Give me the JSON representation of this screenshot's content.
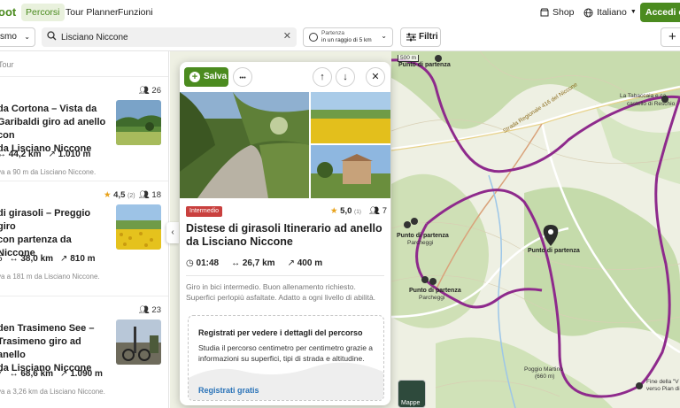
{
  "nav": {
    "brand": "oot",
    "items": [
      "Percorsi",
      "Tour Planner",
      "Funzioni"
    ],
    "shop": "Shop",
    "language": "Italiano",
    "cta": "Accedi o r"
  },
  "search": {
    "sport": "smo",
    "query": "Lisciano Niccone",
    "radius_label": "Partenza",
    "radius_value": "in un raggio di 5 km",
    "filters": "Filtri",
    "add": "+"
  },
  "list": {
    "crumb": "Tour",
    "cards": [
      {
        "title": "da Cortona – Vista da\nGaribaldi giro ad anello con\nda Lisciano Niccone",
        "rating": "",
        "rating_count": "",
        "users": "26",
        "stats_prefix": "",
        "distance": "44,2 km",
        "elevation": "1.010 m",
        "dist_from": "va a 90 m da Lisciano Niccone."
      },
      {
        "title": "di girasoli – Preggio giro\ncon partenza da\nNiccone",
        "rating": "4,5",
        "rating_count": "(2)",
        "users": "18",
        "stats_prefix": "5",
        "distance": "38,0 km",
        "elevation": "810 m",
        "dist_from": "va a 181 m da Lisciano Niccone."
      },
      {
        "title": "den Trasimeno See –\nTrasimeno giro ad anello\nda Lisciano Niccone",
        "rating": "",
        "rating_count": "",
        "users": "23",
        "stats_prefix": "7",
        "distance": "68,6 km",
        "elevation": "1.090 m",
        "dist_from": "va a 3,26 km da Lisciano Niccone."
      }
    ]
  },
  "panel": {
    "save": "Salva",
    "more": "•••",
    "up": "↑",
    "down": "↓",
    "close": "✕",
    "difficulty": "Intermedio",
    "rating": "5,0",
    "rating_count": "(1)",
    "users": "7",
    "title": "Distese di girasoli Itinerario ad anello da Lisciano Niccone",
    "duration": "01:48",
    "distance": "26,7 km",
    "elevation": "400 m",
    "description": "Giro in bici intermedio. Buon allenamento richiesto. Superfici perlopiù asfaltate. Adatto a ogni livello di abilità.",
    "register_title": "Registrati per vedere i dettagli del percorso",
    "register_text": "Studia il percorso centimetro per centimetro grazie a informazioni su superfici, tipi di strada e altitudine.",
    "register_link": "Registrati gratis"
  },
  "map": {
    "scale": "500 m",
    "labels": {
      "start_top": "Punto di partenza",
      "tabaccaia": "La Tabaccaia e ca",
      "castello": "castello di Reschio",
      "road": "Strada Regionale 416 del Niccone",
      "start_a": "Punto di partenza",
      "parcheggi_a": "Parcheggi",
      "start_b": "Punto di partenza",
      "start_c": "Punto di partenza",
      "parcheggi_c": "Parcheggi",
      "poggio": "Poggio Martino",
      "poggio_alt": "(660 m)",
      "fine": "Fine della \"V",
      "verso": "verso Pian di",
      "mappe": "Mappe"
    }
  },
  "colors": {
    "brand": "#4b8b1f",
    "route": "#8e2a8c",
    "chip": "#c9403e",
    "link": "#2a73b8"
  }
}
